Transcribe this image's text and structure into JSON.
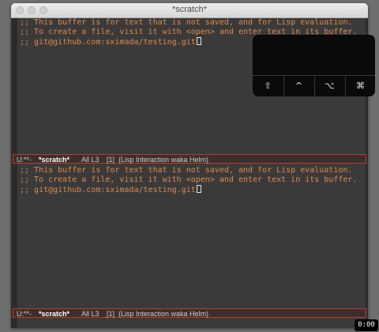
{
  "window": {
    "title": "*scratch*"
  },
  "top_pane": {
    "lines": [
      ";; This buffer is for text that is not saved, and for Lisp evaluation.",
      ";; To create a file, visit it with <open> and enter text in its buffer.",
      ";; git@github.com:sximada/testing.git"
    ]
  },
  "top_modeline": {
    "state": "U:**-",
    "buffer": "*scratch*",
    "position": "All L3",
    "mode": "[1]  (Lisp Interaction waka Helm)"
  },
  "bottom_pane": {
    "lines": [
      ";; This buffer is for text that is not saved, and for Lisp evaluation.",
      ";; To create a file, visit it with <open> and enter text in its buffer.",
      ";; git@github.com:sximada/testing.git"
    ]
  },
  "bottom_modeline": {
    "state": "U:**-",
    "buffer": "*scratch*",
    "position": "All L3",
    "mode": "[1]  (Lisp Interaction waka Helm)"
  },
  "touchbar": {
    "keys": [
      {
        "glyph": "⇧",
        "icon": "shift-icon"
      },
      {
        "glyph": "^",
        "icon": "control-icon"
      },
      {
        "glyph": "⌥",
        "icon": "option-icon"
      },
      {
        "glyph": "⌘",
        "icon": "command-icon"
      }
    ]
  },
  "corner_badge": {
    "text": "0:00"
  },
  "colors": {
    "comment_text": "#e0894a",
    "buffer_background": "#3a3a3a",
    "modeline_border": "#c0392b"
  }
}
